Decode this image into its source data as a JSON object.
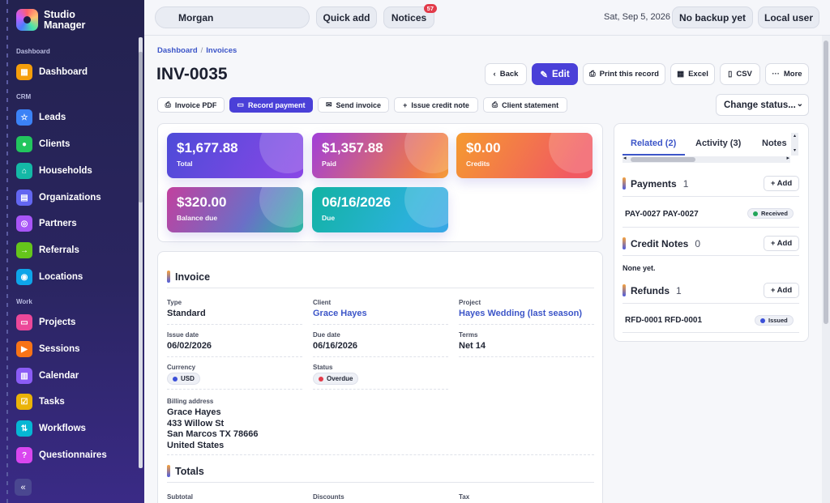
{
  "app": {
    "name": "Studio Manager"
  },
  "sidebar": {
    "groups": [
      {
        "label": "Dashboard"
      },
      {
        "label": "CRM"
      },
      {
        "label": "Work"
      }
    ],
    "items": [
      {
        "label": "Dashboard",
        "icon": "grid-icon",
        "color": "#f59e0b"
      },
      {
        "label": "Leads",
        "icon": "star-icon",
        "color": "#3b82f6"
      },
      {
        "label": "Clients",
        "icon": "person-icon",
        "color": "#22c55e"
      },
      {
        "label": "Households",
        "icon": "home-icon",
        "color": "#14b8a6"
      },
      {
        "label": "Organizations",
        "icon": "building-icon",
        "color": "#6366f1"
      },
      {
        "label": "Partners",
        "icon": "handshake-icon",
        "color": "#a855f7"
      },
      {
        "label": "Referrals",
        "icon": "arrow-right-icon",
        "color": "#65c51b"
      },
      {
        "label": "Locations",
        "icon": "pin-icon",
        "color": "#0ea5e9"
      },
      {
        "label": "Projects",
        "icon": "folder-icon",
        "color": "#ec4899"
      },
      {
        "label": "Sessions",
        "icon": "video-icon",
        "color": "#f97316"
      },
      {
        "label": "Calendar",
        "icon": "calendar-icon",
        "color": "#8b5cf6"
      },
      {
        "label": "Tasks",
        "icon": "checkbox-icon",
        "color": "#eab308"
      },
      {
        "label": "Workflows",
        "icon": "workflow-icon",
        "color": "#06b6d4"
      },
      {
        "label": "Questionnaires",
        "icon": "question-icon",
        "color": "#d946ef"
      }
    ],
    "collapse_glyph": "«"
  },
  "topbar": {
    "search_value": "Morgan",
    "quick_add": "Quick add",
    "notices": "Notices",
    "notices_count": "57",
    "date": "Sat, Sep 5, 2026",
    "backup": "No backup yet",
    "user": "Local user"
  },
  "breadcrumb": {
    "root": "Dashboard",
    "sep": "/",
    "current": "Invoices"
  },
  "page": {
    "title": "INV-0035"
  },
  "actions": {
    "back": "Back",
    "edit": "Edit",
    "print": "Print this record",
    "excel": "Excel",
    "csv": "CSV",
    "more": "More"
  },
  "sub_actions": {
    "invoice_pdf": "Invoice PDF",
    "record_payment": "Record payment",
    "send_invoice": "Send invoice",
    "issue_credit": "Issue credit note",
    "client_statement": "Client statement",
    "change_status": "Change status..."
  },
  "stats": [
    {
      "value": "$1,677.88",
      "label": "Total"
    },
    {
      "value": "$1,357.88",
      "label": "Paid"
    },
    {
      "value": "$0.00",
      "label": "Credits"
    },
    {
      "value": "$320.00",
      "label": "Balance due"
    },
    {
      "value": "06/16/2026",
      "label": "Due"
    }
  ],
  "invoice": {
    "heading": "Invoice",
    "type_label": "Type",
    "type": "Standard",
    "client_label": "Client",
    "client": "Grace Hayes",
    "project_label": "Project",
    "project": "Hayes Wedding (last season)",
    "issue_label": "Issue date",
    "issue": "06/02/2026",
    "due_label": "Due date",
    "due": "06/16/2026",
    "terms_label": "Terms",
    "terms": "Net 14",
    "currency_label": "Currency",
    "currency": "USD",
    "status_label": "Status",
    "status": "Overdue",
    "billing_label": "Billing address",
    "billing": [
      "Grace Hayes",
      "433 Willow St",
      "San Marcos TX 78666",
      "United States"
    ]
  },
  "totals": {
    "heading": "Totals",
    "subtotal_label": "Subtotal",
    "discounts_label": "Discounts",
    "tax_label": "Tax"
  },
  "related": {
    "tabs": [
      "Related (2)",
      "Activity (3)",
      "Notes"
    ],
    "payments": {
      "title": "Payments",
      "count": "1",
      "add": "+ Add",
      "row": "PAY-0027 PAY-0027",
      "status": "Received"
    },
    "credit_notes": {
      "title": "Credit Notes",
      "count": "0",
      "add": "+ Add",
      "empty": "None yet."
    },
    "refunds": {
      "title": "Refunds",
      "count": "1",
      "add": "+ Add",
      "row": "RFD-0001 RFD-0001",
      "status": "Issued"
    }
  },
  "colors": {
    "accent": "#4a40d8",
    "link": "#3c55c8",
    "received": "#22a55a",
    "issued": "#3b4fd8",
    "overdue": "#e23b4a",
    "usd": "#3b4fd8"
  }
}
